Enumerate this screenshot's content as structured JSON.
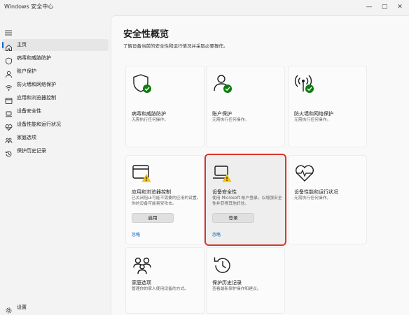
{
  "window": {
    "title": "Windows 安全中心"
  },
  "sidebar": {
    "items": [
      {
        "label": "主页"
      },
      {
        "label": "病毒和威胁防护"
      },
      {
        "label": "账户保护"
      },
      {
        "label": "防火墙和网络保护"
      },
      {
        "label": "应用和浏览器控制"
      },
      {
        "label": "设备安全性"
      },
      {
        "label": "设备性能和运行状况"
      },
      {
        "label": "家庭选项"
      },
      {
        "label": "保护历史记录"
      }
    ],
    "settings": "设置"
  },
  "main": {
    "title": "安全性概览",
    "subtitle": "了解设备当前的安全性和运行情况并采取必要操作。",
    "cards": [
      {
        "title": "病毒和威胁防护",
        "desc": "无需执行任何操作。"
      },
      {
        "title": "账户保护",
        "desc": "无需执行任何操作。"
      },
      {
        "title": "防火墙和网络保护",
        "desc": "无需执行任何操作。"
      },
      {
        "title": "应用和浏览器控制",
        "desc": "已关闭阻止可能不需要的应用的设置。你的设备可能易受攻击。",
        "button": "启用",
        "link": "忽略"
      },
      {
        "title": "设备安全性",
        "desc": "使用 Microsoft 帐户登录，以增强安全性并获得其他好处。",
        "button": "登录",
        "link": "忽略"
      },
      {
        "title": "设备性能和运行状况",
        "desc": "无需执行任何操作。"
      },
      {
        "title": "家庭选项",
        "desc": "管理你的家人使用设备的方式。"
      },
      {
        "title": "保护历史记录",
        "desc": "查看最新保护操作和建议。"
      }
    ]
  },
  "colors": {
    "accent": "#0067c0",
    "ok": "#0f7b0f",
    "warn": "#f7c000",
    "highlight": "#d9362b",
    "link": "#005fb8"
  }
}
